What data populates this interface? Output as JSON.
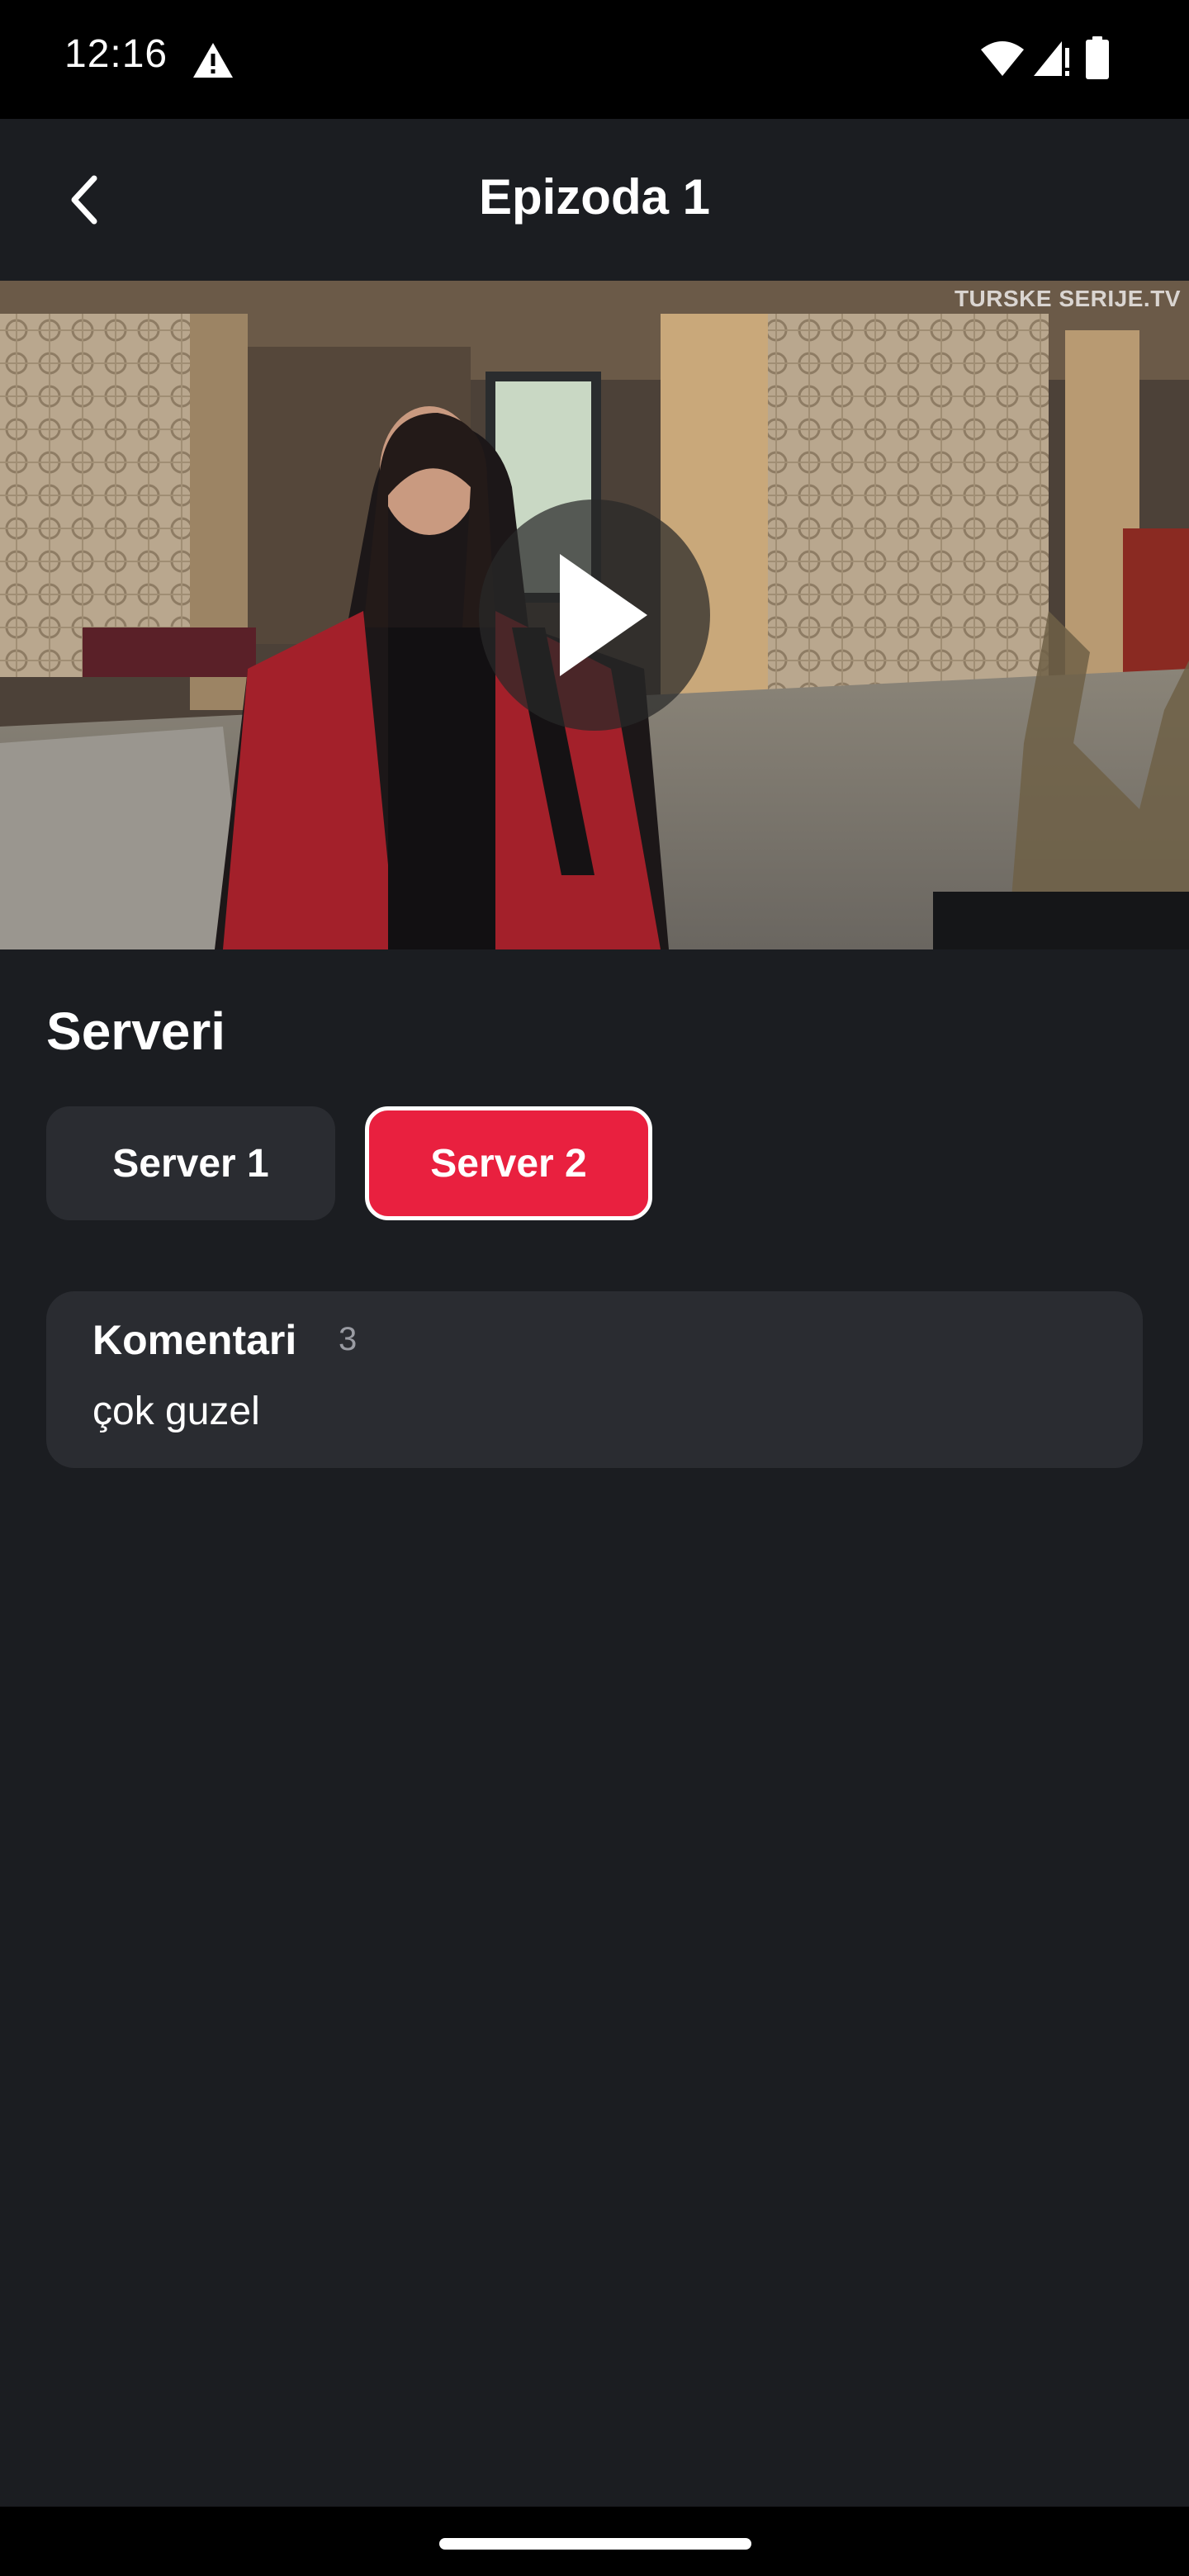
{
  "status_bar": {
    "time": "12:16",
    "icons": [
      "warning-icon",
      "wifi-icon",
      "signal-icon",
      "battery-icon"
    ]
  },
  "header": {
    "title": "Epizoda 1",
    "back_icon": "chevron-left-icon"
  },
  "video": {
    "watermark": "TURSKE SERIJE.TV",
    "play_icon": "play-icon"
  },
  "servers": {
    "title": "Serveri",
    "items": [
      {
        "label": "Server 1",
        "selected": false
      },
      {
        "label": "Server 2",
        "selected": true
      }
    ]
  },
  "comments": {
    "title": "Komentari",
    "count": "3",
    "preview": "çok guzel"
  },
  "colors": {
    "background": "#1b1d21",
    "card": "#2a2c31",
    "accent": "#e9203f"
  }
}
